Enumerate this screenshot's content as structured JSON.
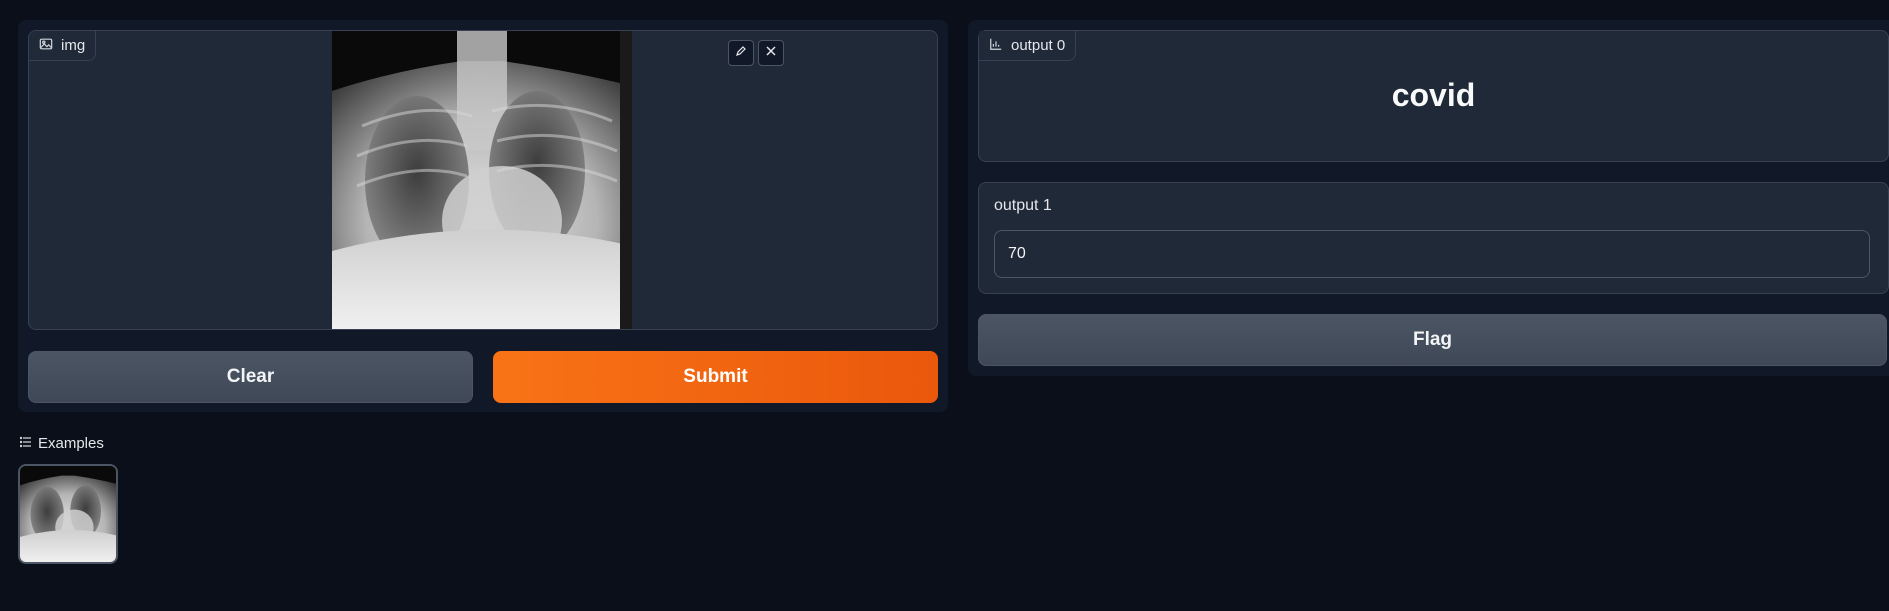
{
  "input": {
    "image_label": "img",
    "edit_icon": "pencil-icon",
    "remove_icon": "close-icon"
  },
  "buttons": {
    "clear": "Clear",
    "submit": "Submit",
    "flag": "Flag"
  },
  "outputs": [
    {
      "label": "output 0",
      "value": "covid",
      "icon": "bar-chart-icon"
    },
    {
      "label": "output 1",
      "value": "70"
    }
  ],
  "examples": {
    "header": "Examples",
    "icon": "list-icon",
    "items": [
      {
        "type": "image",
        "description_icon": "x-ray-thumbnail"
      }
    ]
  },
  "colors": {
    "background": "#0b0f19",
    "panel": "#111827",
    "block": "#1f2937",
    "primary": "#f97316",
    "secondary": "#4b5563"
  }
}
